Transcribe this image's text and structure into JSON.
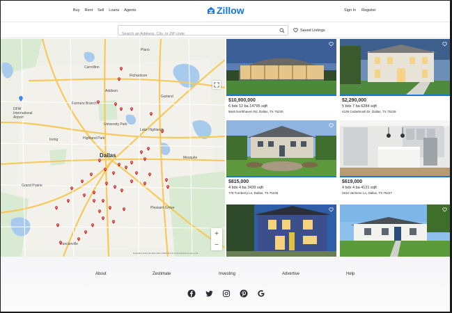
{
  "header": {
    "nav_left": [
      "Buy",
      "Rent",
      "Sell",
      "Loans",
      "Agents"
    ],
    "logo": "Zillow",
    "nav_right": [
      "Sign In",
      "Register"
    ]
  },
  "search": {
    "placeholder": "Search an Address, City, or ZIP code",
    "saved_label": "Saved Listings"
  },
  "map": {
    "city_label": "Dallas",
    "labels": [
      "Plano",
      "Garland",
      "Irving",
      "Richardson",
      "Farmers Branch",
      "University Park",
      "Mesquite",
      "Grand Prairie",
      "Duncanville",
      "DFW International Airport",
      "Carrollton",
      "Addison",
      "Lake Highlands",
      "Pleasant Grove",
      "Highland Park"
    ],
    "attribution": "Keyboard shortcuts   Map data ©2023   Terms of Use   Report a map error",
    "zoom_in": "+",
    "zoom_out": "−"
  },
  "listings": [
    {
      "price": "$10,900,000",
      "details": "6 bds 12 ba 14795 sqft",
      "address": "5646 Northhaven Rd, Dallas, TX 75230"
    },
    {
      "price": "$2,290,000",
      "details": "5 bds 7 ba 6284 sqft",
      "address": "4109 Cedarbrush Dr, Dallas, TX 75229"
    },
    {
      "price": "$815,000",
      "details": "4 bds 4 ba 3439 sqft",
      "address": "778 Turnberry Ln, Dallas, TX 75248"
    },
    {
      "price": "$619,000",
      "details": "4 bds 4 ba 4121 sqft",
      "address": "2810 Vacherie Ln, Dallas, TX 75227"
    },
    {
      "price": "",
      "details": "",
      "address": ""
    },
    {
      "price": "",
      "details": "",
      "address": ""
    }
  ],
  "footer": {
    "links": [
      "About",
      "Zestimate",
      "Investing",
      "Advertise",
      "Help"
    ],
    "social_icons": [
      "facebook-icon",
      "twitter-icon",
      "instagram-icon",
      "pinterest-icon",
      "google-icon"
    ]
  },
  "colors": {
    "brand": "#1277e1",
    "pin": "#d32323"
  }
}
